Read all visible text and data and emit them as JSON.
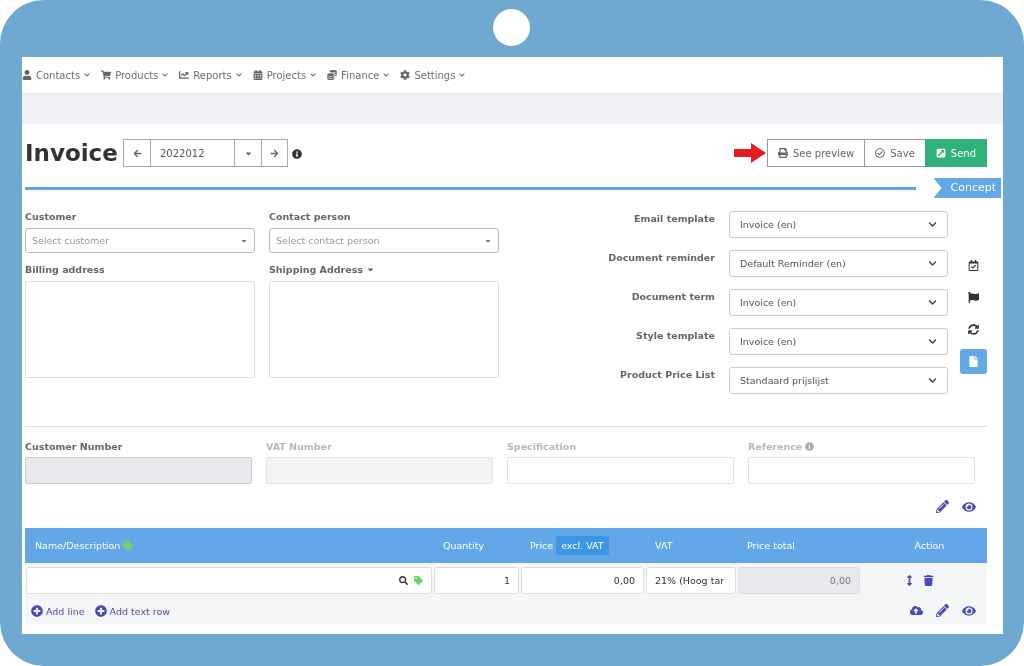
{
  "nav": [
    {
      "label": "Contacts"
    },
    {
      "label": "Products"
    },
    {
      "label": "Reports"
    },
    {
      "label": "Projects"
    },
    {
      "label": "Finance"
    },
    {
      "label": "Settings"
    }
  ],
  "title": "Invoice",
  "number": {
    "value": "2022012"
  },
  "actions": [
    {
      "label": "See preview",
      "kind": "preview"
    },
    {
      "label": "Save",
      "kind": "save"
    },
    {
      "label": "Send",
      "kind": "send"
    }
  ],
  "status": "Concept",
  "customer": {
    "label": "Customer",
    "placeholder": "Select customer"
  },
  "contact": {
    "label": "Contact person",
    "placeholder": "Select contact person"
  },
  "billing": {
    "label": "Billing address"
  },
  "shipping": {
    "label": "Shipping Address"
  },
  "settings": [
    {
      "label": "Email template",
      "value": "Invoice (en)"
    },
    {
      "label": "Document reminder",
      "value": "Default Reminder (en)"
    },
    {
      "label": "Document term",
      "value": "Invoice (en)"
    },
    {
      "label": "Style template",
      "value": "Invoice (en)"
    },
    {
      "label": "Product Price List",
      "value": "Standaard prijslijst"
    }
  ],
  "side_tools": [
    {
      "kind": "calendar",
      "selected": false
    },
    {
      "kind": "flag",
      "selected": false
    },
    {
      "kind": "sync",
      "selected": false
    },
    {
      "kind": "document",
      "selected": true
    }
  ],
  "meta_fields": [
    {
      "label": "Customer Number",
      "kind": "readonly"
    },
    {
      "label": "VAT Number",
      "kind": "disabled"
    },
    {
      "label": "Specification",
      "kind": "text"
    },
    {
      "label": "Reference",
      "kind": "text",
      "info": true
    }
  ],
  "table": {
    "columns": [
      {
        "label": "Name/Description",
        "tag": true
      },
      {
        "label": "Quantity"
      },
      {
        "label": "Price",
        "badge": "excl. VAT"
      },
      {
        "label": "VAT"
      },
      {
        "label": "Price total"
      },
      {
        "label": "Action"
      }
    ],
    "rows": [
      {
        "quantity": "1",
        "price": "0,00",
        "vat": "21% (Hoog tar",
        "total": "0,00"
      }
    ]
  },
  "footer_links": [
    {
      "label": "Add line"
    },
    {
      "label": "Add text row"
    }
  ]
}
